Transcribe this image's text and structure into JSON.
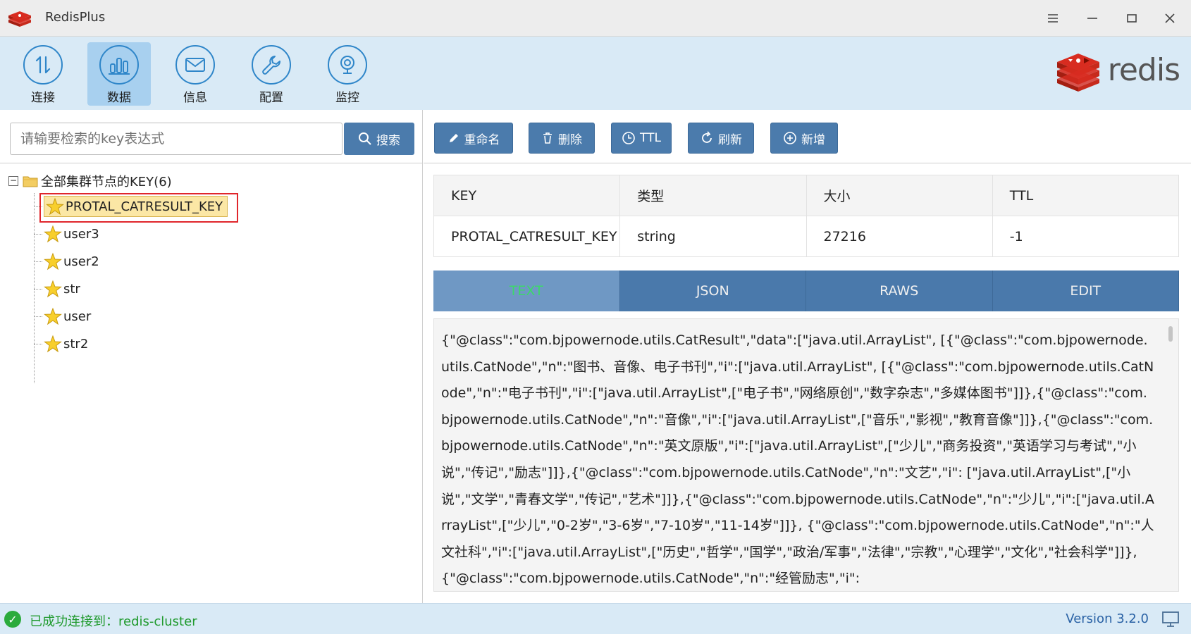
{
  "window": {
    "title": "RedisPlus",
    "controls": [
      "menu-icon",
      "minimize-icon",
      "maximize-icon",
      "close-icon"
    ]
  },
  "toolbar": {
    "items": [
      {
        "label": "连接",
        "icon": "connect-arrows-icon"
      },
      {
        "label": "数据",
        "icon": "bar-chart-icon",
        "active": true
      },
      {
        "label": "信息",
        "icon": "mail-icon"
      },
      {
        "label": "配置",
        "icon": "wrench-icon"
      },
      {
        "label": "监控",
        "icon": "monitor-camera-icon"
      }
    ],
    "brand": "redis"
  },
  "search": {
    "placeholder": "请输要检索的key表达式",
    "button_label": "搜索"
  },
  "tree": {
    "root_label": "全部集群节点的KEY(6)",
    "items": [
      {
        "label": "PROTAL_CATRESULT_KEY",
        "selected": true
      },
      {
        "label": "user3"
      },
      {
        "label": "user2"
      },
      {
        "label": "str"
      },
      {
        "label": "user"
      },
      {
        "label": "str2"
      }
    ]
  },
  "actions": {
    "rename": "重命名",
    "delete": "删除",
    "ttl": "TTL",
    "refresh": "刷新",
    "add": "新增"
  },
  "key_info": {
    "headers": [
      "KEY",
      "类型",
      "大小",
      "TTL"
    ],
    "values": [
      "PROTAL_CATRESULT_KEY",
      "string",
      "27216",
      "-1"
    ]
  },
  "view_tabs": {
    "items": [
      "TEXT",
      "JSON",
      "RAWS",
      "EDIT"
    ],
    "active": "TEXT"
  },
  "value_text": "{\"@class\":\"com.bjpowernode.utils.CatResult\",\"data\":[\"java.util.ArrayList\", [{\"@class\":\"com.bjpowernode.utils.CatNode\",\"n\":\"图书、音像、电子书刊\",\"i\":[\"java.util.ArrayList\", [{\"@class\":\"com.bjpowernode.utils.CatNode\",\"n\":\"电子书刊\",\"i\":[\"java.util.ArrayList\",[\"电子书\",\"网络原创\",\"数字杂志\",\"多媒体图书\"]]},{\"@class\":\"com.bjpowernode.utils.CatNode\",\"n\":\"音像\",\"i\":[\"java.util.ArrayList\",[\"音乐\",\"影视\",\"教育音像\"]]},{\"@class\":\"com.bjpowernode.utils.CatNode\",\"n\":\"英文原版\",\"i\":[\"java.util.ArrayList\",[\"少儿\",\"商务投资\",\"英语学习与考试\",\"小说\",\"传记\",\"励志\"]]},{\"@class\":\"com.bjpowernode.utils.CatNode\",\"n\":\"文艺\",\"i\": [\"java.util.ArrayList\",[\"小说\",\"文学\",\"青春文学\",\"传记\",\"艺术\"]]},{\"@class\":\"com.bjpowernode.utils.CatNode\",\"n\":\"少儿\",\"i\":[\"java.util.ArrayList\",[\"少儿\",\"0-2岁\",\"3-6岁\",\"7-10岁\",\"11-14岁\"]]}, {\"@class\":\"com.bjpowernode.utils.CatNode\",\"n\":\"人文社科\",\"i\":[\"java.util.ArrayList\",[\"历史\",\"哲学\",\"国学\",\"政治/军事\",\"法律\",\"宗教\",\"心理学\",\"文化\",\"社会科学\"]]},{\"@class\":\"com.bjpowernode.utils.CatNode\",\"n\":\"经管励志\",\"i\":",
  "status": {
    "message": "已成功连接到：redis-cluster",
    "version": "Version 3.2.0"
  },
  "colors": {
    "toolbar_bg": "#d9eaf6",
    "button_blue": "#4b7bac",
    "tab_active_text": "#3cd86a",
    "status_green": "#1f9a2d",
    "selection_outline": "#e0262c"
  }
}
